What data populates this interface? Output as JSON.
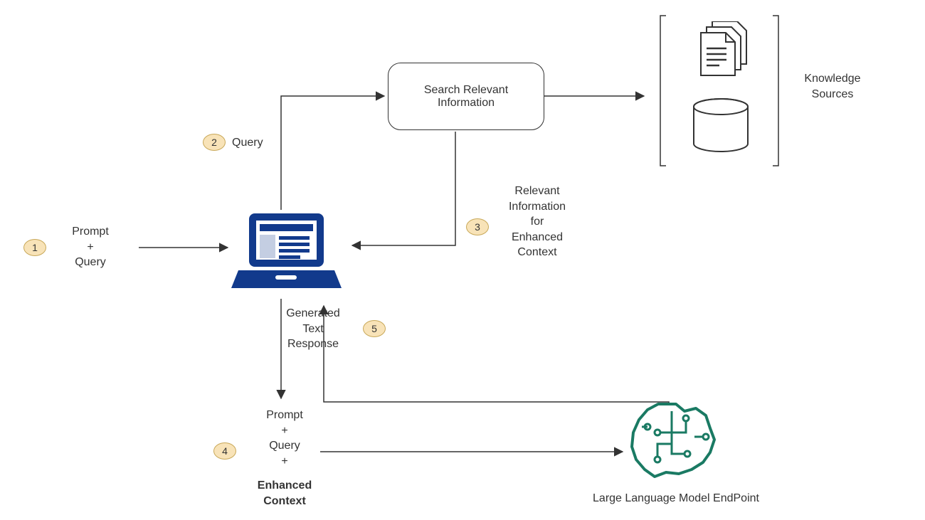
{
  "steps": {
    "s1": "1",
    "s2": "2",
    "s3": "3",
    "s4": "4",
    "s5": "5"
  },
  "labels": {
    "prompt_query": "Prompt\n+\nQuery",
    "query": "Query",
    "search_box": "Search Relevant\nInformation",
    "relevant_info": "Relevant\nInformation\nfor\nEnhanced\nContext",
    "knowledge_sources": "Knowledge\nSources",
    "generated_response": "Generated\nText\nResponse",
    "prompt_query_enhanced_top": "Prompt\n+\nQuery\n+",
    "prompt_query_enhanced_bold": "Enhanced\nContext",
    "llm_endpoint": "Large Language Model EndPoint"
  }
}
